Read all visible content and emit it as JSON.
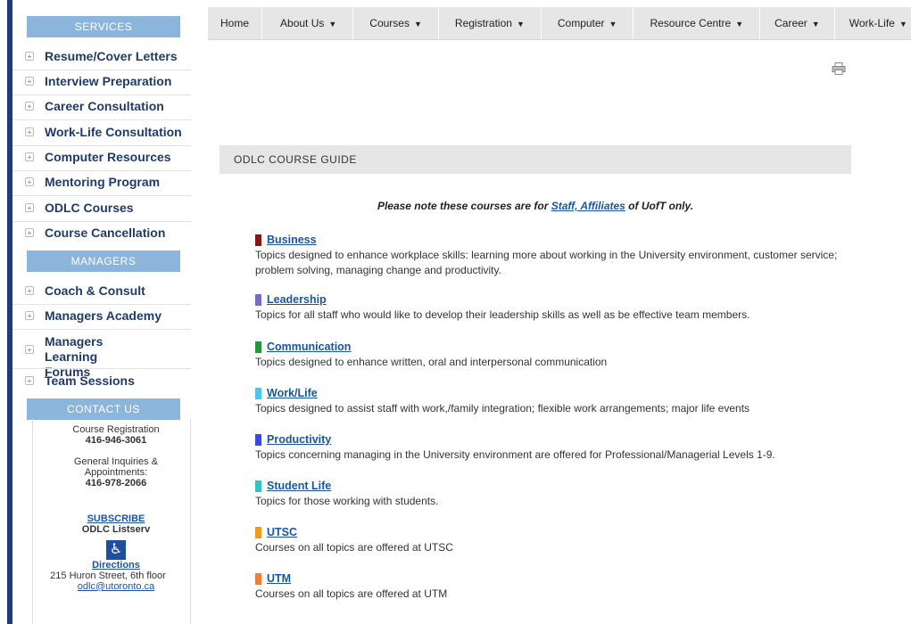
{
  "sidebar": {
    "services_header": "SERVICES",
    "services": [
      {
        "label": "Resume/Cover Letters"
      },
      {
        "label": "Interview Preparation"
      },
      {
        "label": "Career Consultation"
      },
      {
        "label": "Work-Life Consultation"
      },
      {
        "label": "Computer Resources"
      },
      {
        "label": "Mentoring Program"
      },
      {
        "label": "ODLC Courses"
      },
      {
        "label": "Course Cancellation"
      }
    ],
    "managers_header": "MANAGERS",
    "managers": [
      {
        "label": "Coach & Consult"
      },
      {
        "label": "Managers Academy"
      },
      {
        "label": "Managers Learning Forums"
      },
      {
        "label": "Team Sessions"
      }
    ],
    "contact_header": "CONTACT US",
    "contact": {
      "registration_label": "Course Registration",
      "registration_phone": "416-946-3061",
      "inquiries_label": "General Inquiries & Appointments:",
      "inquiries_phone": "416-978-2066",
      "subscribe_link": "SUBSCRIBE",
      "listserv": "ODLC Listserv",
      "directions_link": "Directions",
      "address": "215 Huron Street, 6th floor",
      "email": "odlc@utoronto.ca"
    }
  },
  "nav": [
    {
      "label": "Home",
      "dropdown": false
    },
    {
      "label": "About Us",
      "dropdown": true
    },
    {
      "label": "Courses",
      "dropdown": true
    },
    {
      "label": "Registration",
      "dropdown": true
    },
    {
      "label": "Computer",
      "dropdown": true
    },
    {
      "label": "Resource Centre",
      "dropdown": true
    },
    {
      "label": "Career",
      "dropdown": true
    },
    {
      "label": "Work-Life",
      "dropdown": true
    }
  ],
  "main": {
    "guide_title": "ODLC COURSE GUIDE",
    "note_prefix": "Please note these courses are for ",
    "note_link": "Staff, Affiliates",
    "note_suffix": " of UofT only.",
    "courses": [
      {
        "title": "Business",
        "color": "#8b1414",
        "desc": "Topics designed to enhance workplace skills: learning more about working in the University environment, customer service; problem solving, managing change and productivity."
      },
      {
        "title": "Leadership",
        "color": "#7b6bc4",
        "desc": "Topics for all staff who would like to develop their leadership skills as well as be effective team members."
      },
      {
        "title": "Communication",
        "color": "#1e9a3c",
        "desc": "Topics designed to enhance  written, oral and interpersonal communication"
      },
      {
        "title": "Work/Life",
        "color": "#4ac6e8",
        "desc": "Topics designed to assist staff with work,/family integration; flexible work arrangements; major life events"
      },
      {
        "title": "Productivity",
        "color": "#3a4ae0",
        "desc": "Topics concerning managing in the University environment are offered for Professional/Managerial Levels 1-9."
      },
      {
        "title": "Student Life",
        "color": "#2ec4c4",
        "desc": "Topics for those working with students."
      },
      {
        "title": "UTSC",
        "color": "#f39a1e",
        "desc": "Courses on all topics are offered at UTSC"
      },
      {
        "title": "UTM",
        "color": "#f08030",
        "desc": "Courses on all topics are offered at UTM"
      }
    ]
  }
}
